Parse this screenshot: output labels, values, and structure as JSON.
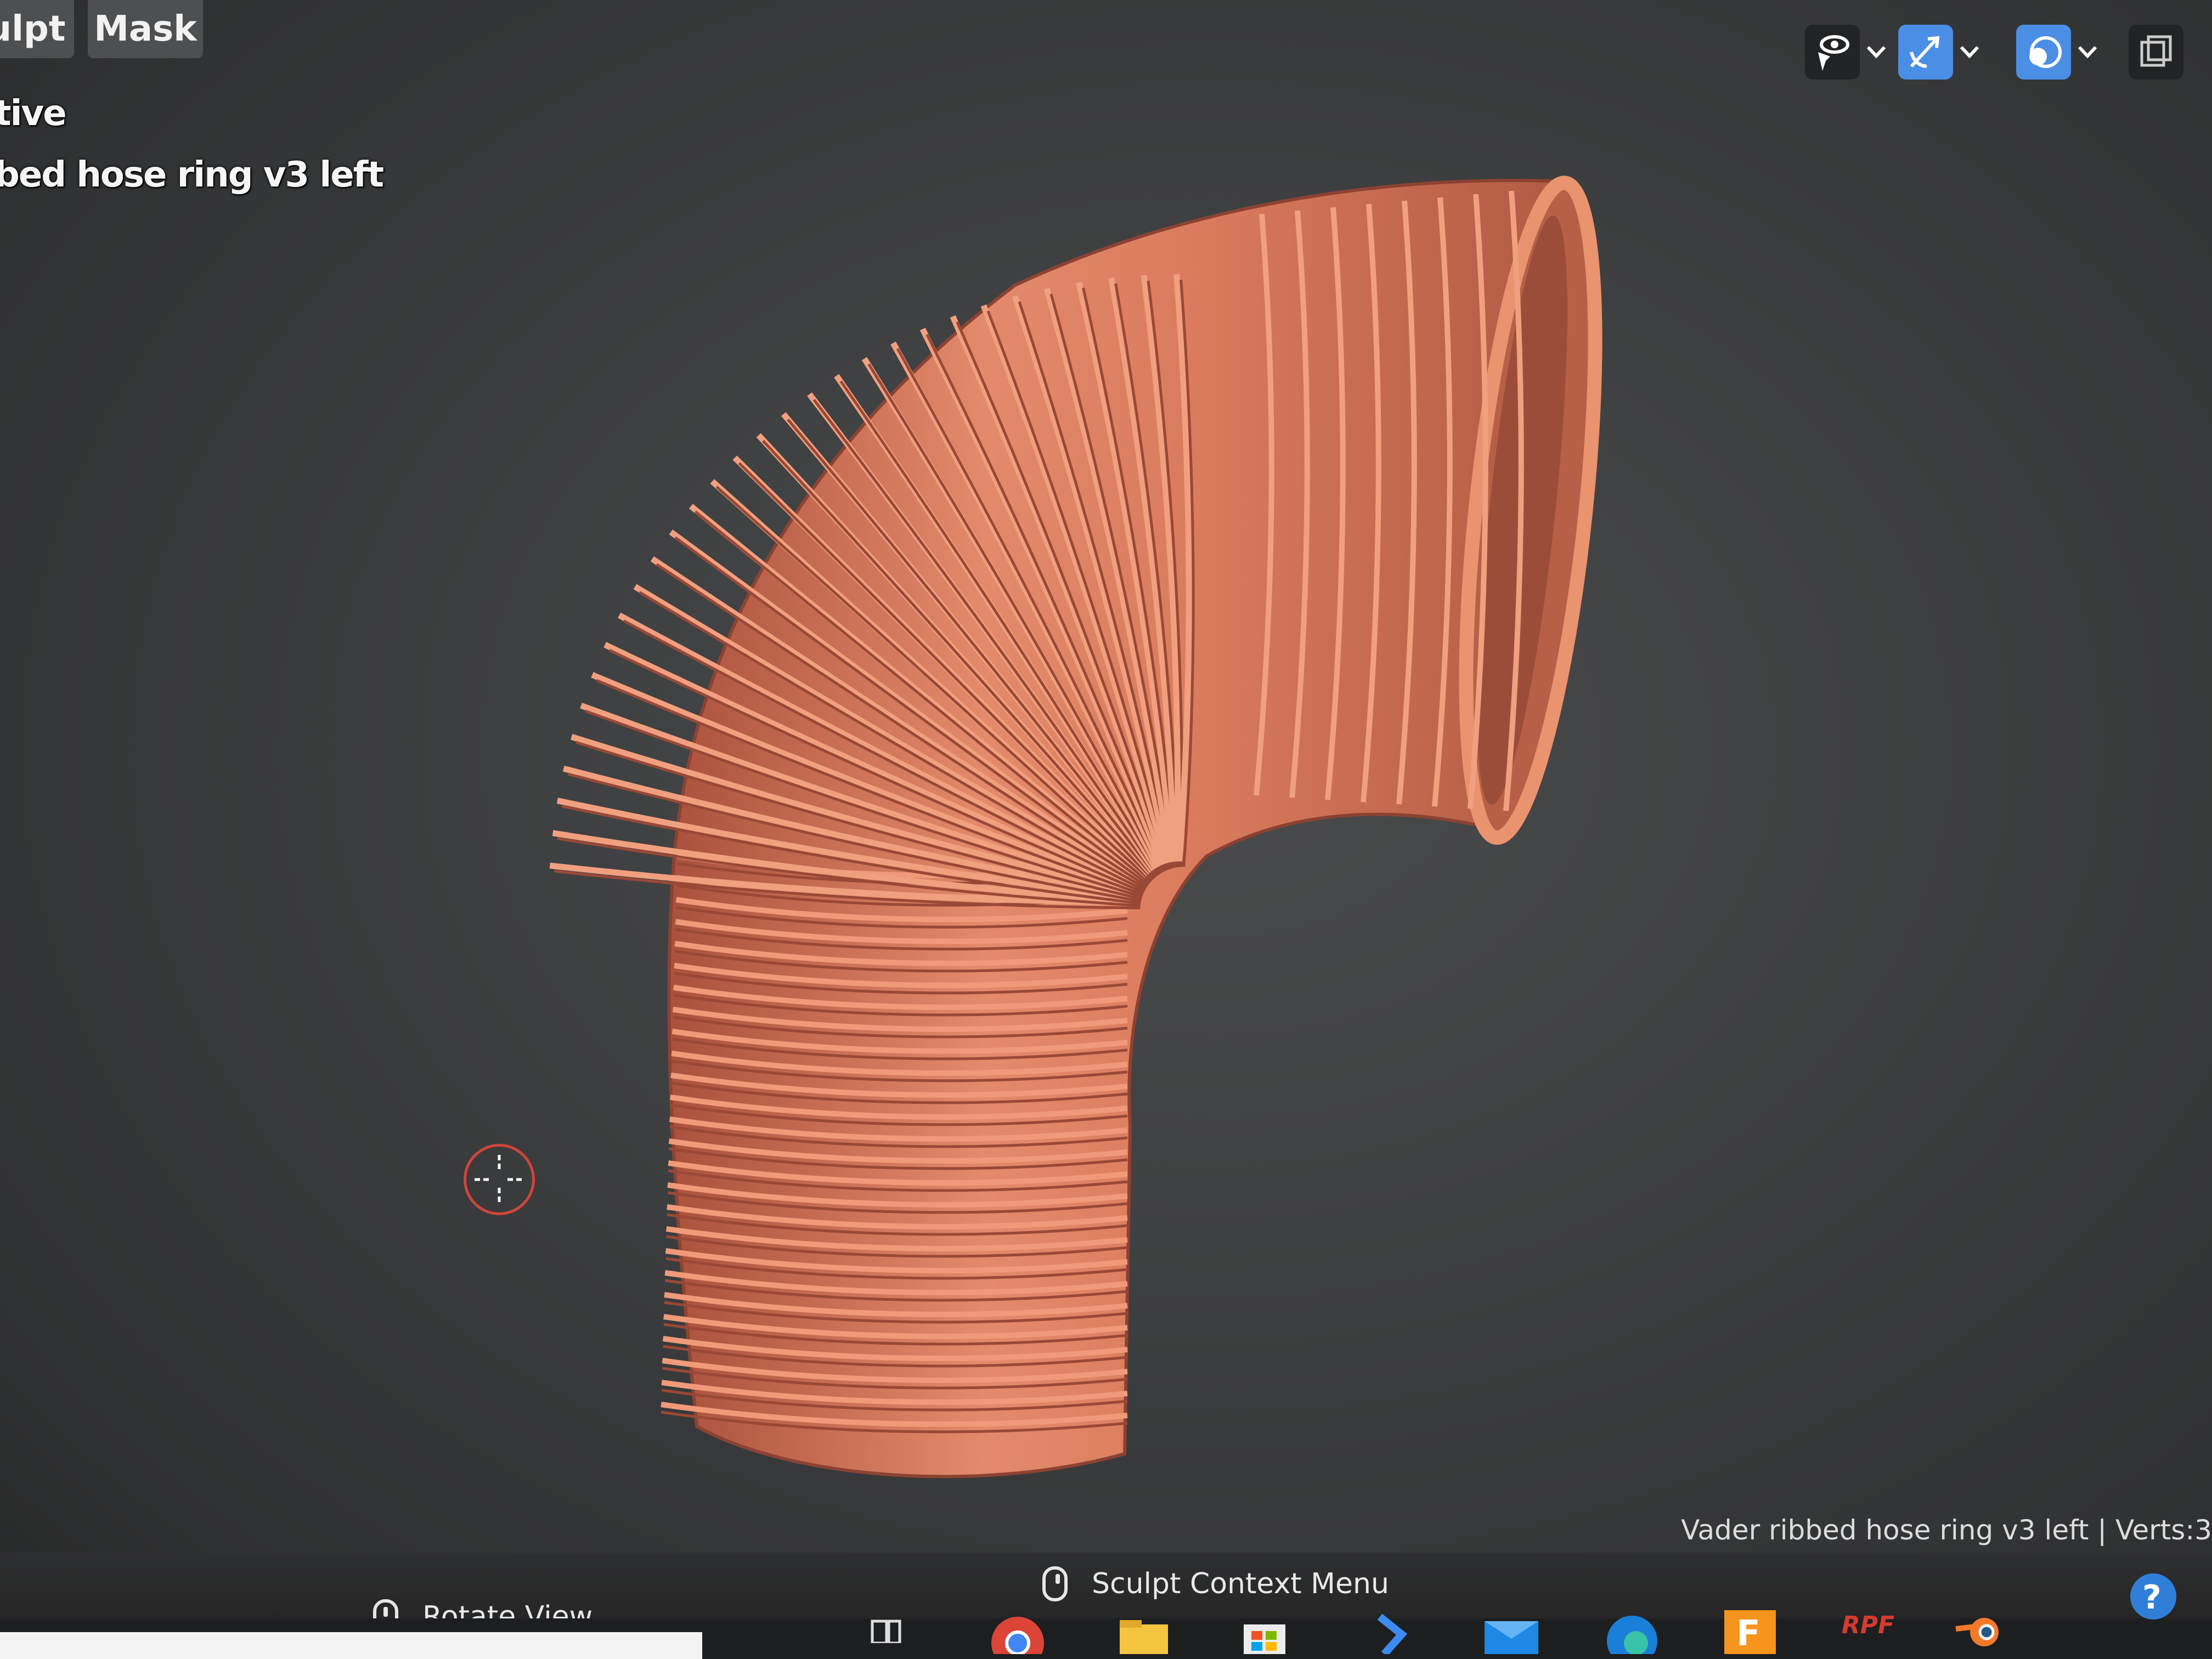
{
  "header": {
    "tabs": [
      {
        "label": "ulpt"
      },
      {
        "label": "Mask"
      }
    ]
  },
  "overlay": {
    "mode_text": "tive",
    "object_text": "bed hose ring v3 left"
  },
  "statusbar": {
    "rotate_label": "Rotate View",
    "context_label": "Sculpt Context Menu",
    "info": "Vader ribbed hose ring v3 left | Verts:3"
  },
  "taskbar": {
    "app_labels": [
      "RPF"
    ]
  },
  "colors": {
    "viewport_bg": "#3d3e3f",
    "mesh": "#d97a5c",
    "accent_blue": "#4a8ee6",
    "cursor": "#d0453c"
  }
}
